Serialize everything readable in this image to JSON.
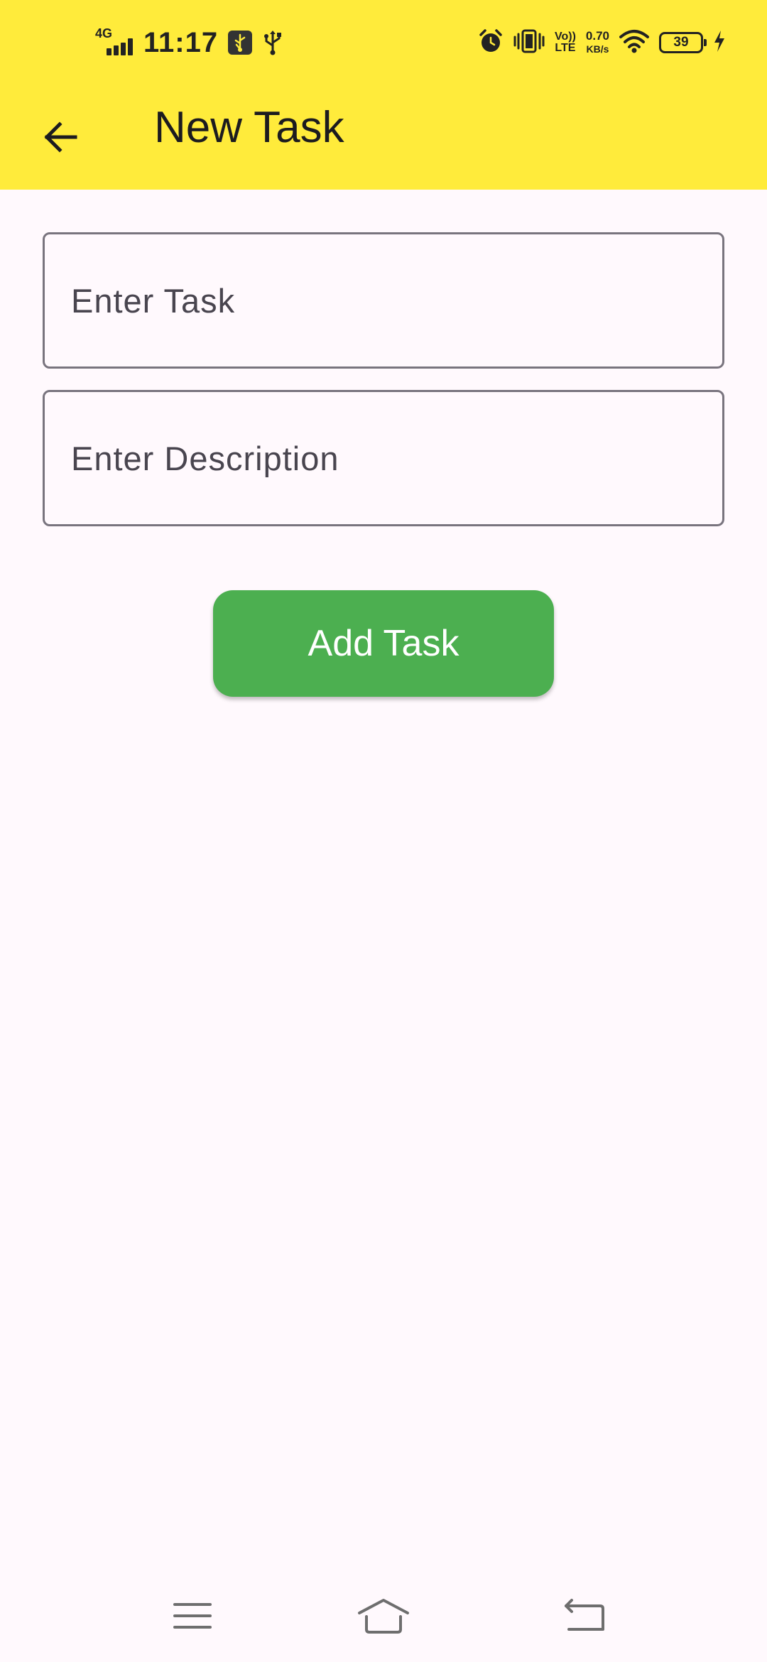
{
  "status_bar": {
    "network_gen": "4G",
    "time": "11:17",
    "volte_top": "Vo))",
    "volte_bottom": "LTE",
    "speed_value": "0.70",
    "speed_unit": "KB/s",
    "battery_level": "39",
    "icons": [
      "signal-icon",
      "usb-debug-icon",
      "usb-icon",
      "alarm-icon",
      "vibrate-icon",
      "wifi-icon",
      "battery-icon",
      "charging-icon"
    ]
  },
  "toolbar": {
    "title": "New Task",
    "back_icon": "arrow-back-icon"
  },
  "form": {
    "task_placeholder": "Enter Task",
    "task_value": "",
    "description_placeholder": "Enter Description",
    "description_value": "",
    "submit_label": "Add Task"
  },
  "nav_bar": {
    "icons": [
      "menu-icon",
      "home-icon",
      "back-icon"
    ]
  },
  "colors": {
    "app_bar": "#FFEB3B",
    "background": "#FFF9FD",
    "button": "#4CAF50",
    "button_text": "#FFFFFF",
    "field_border": "#79747E"
  }
}
